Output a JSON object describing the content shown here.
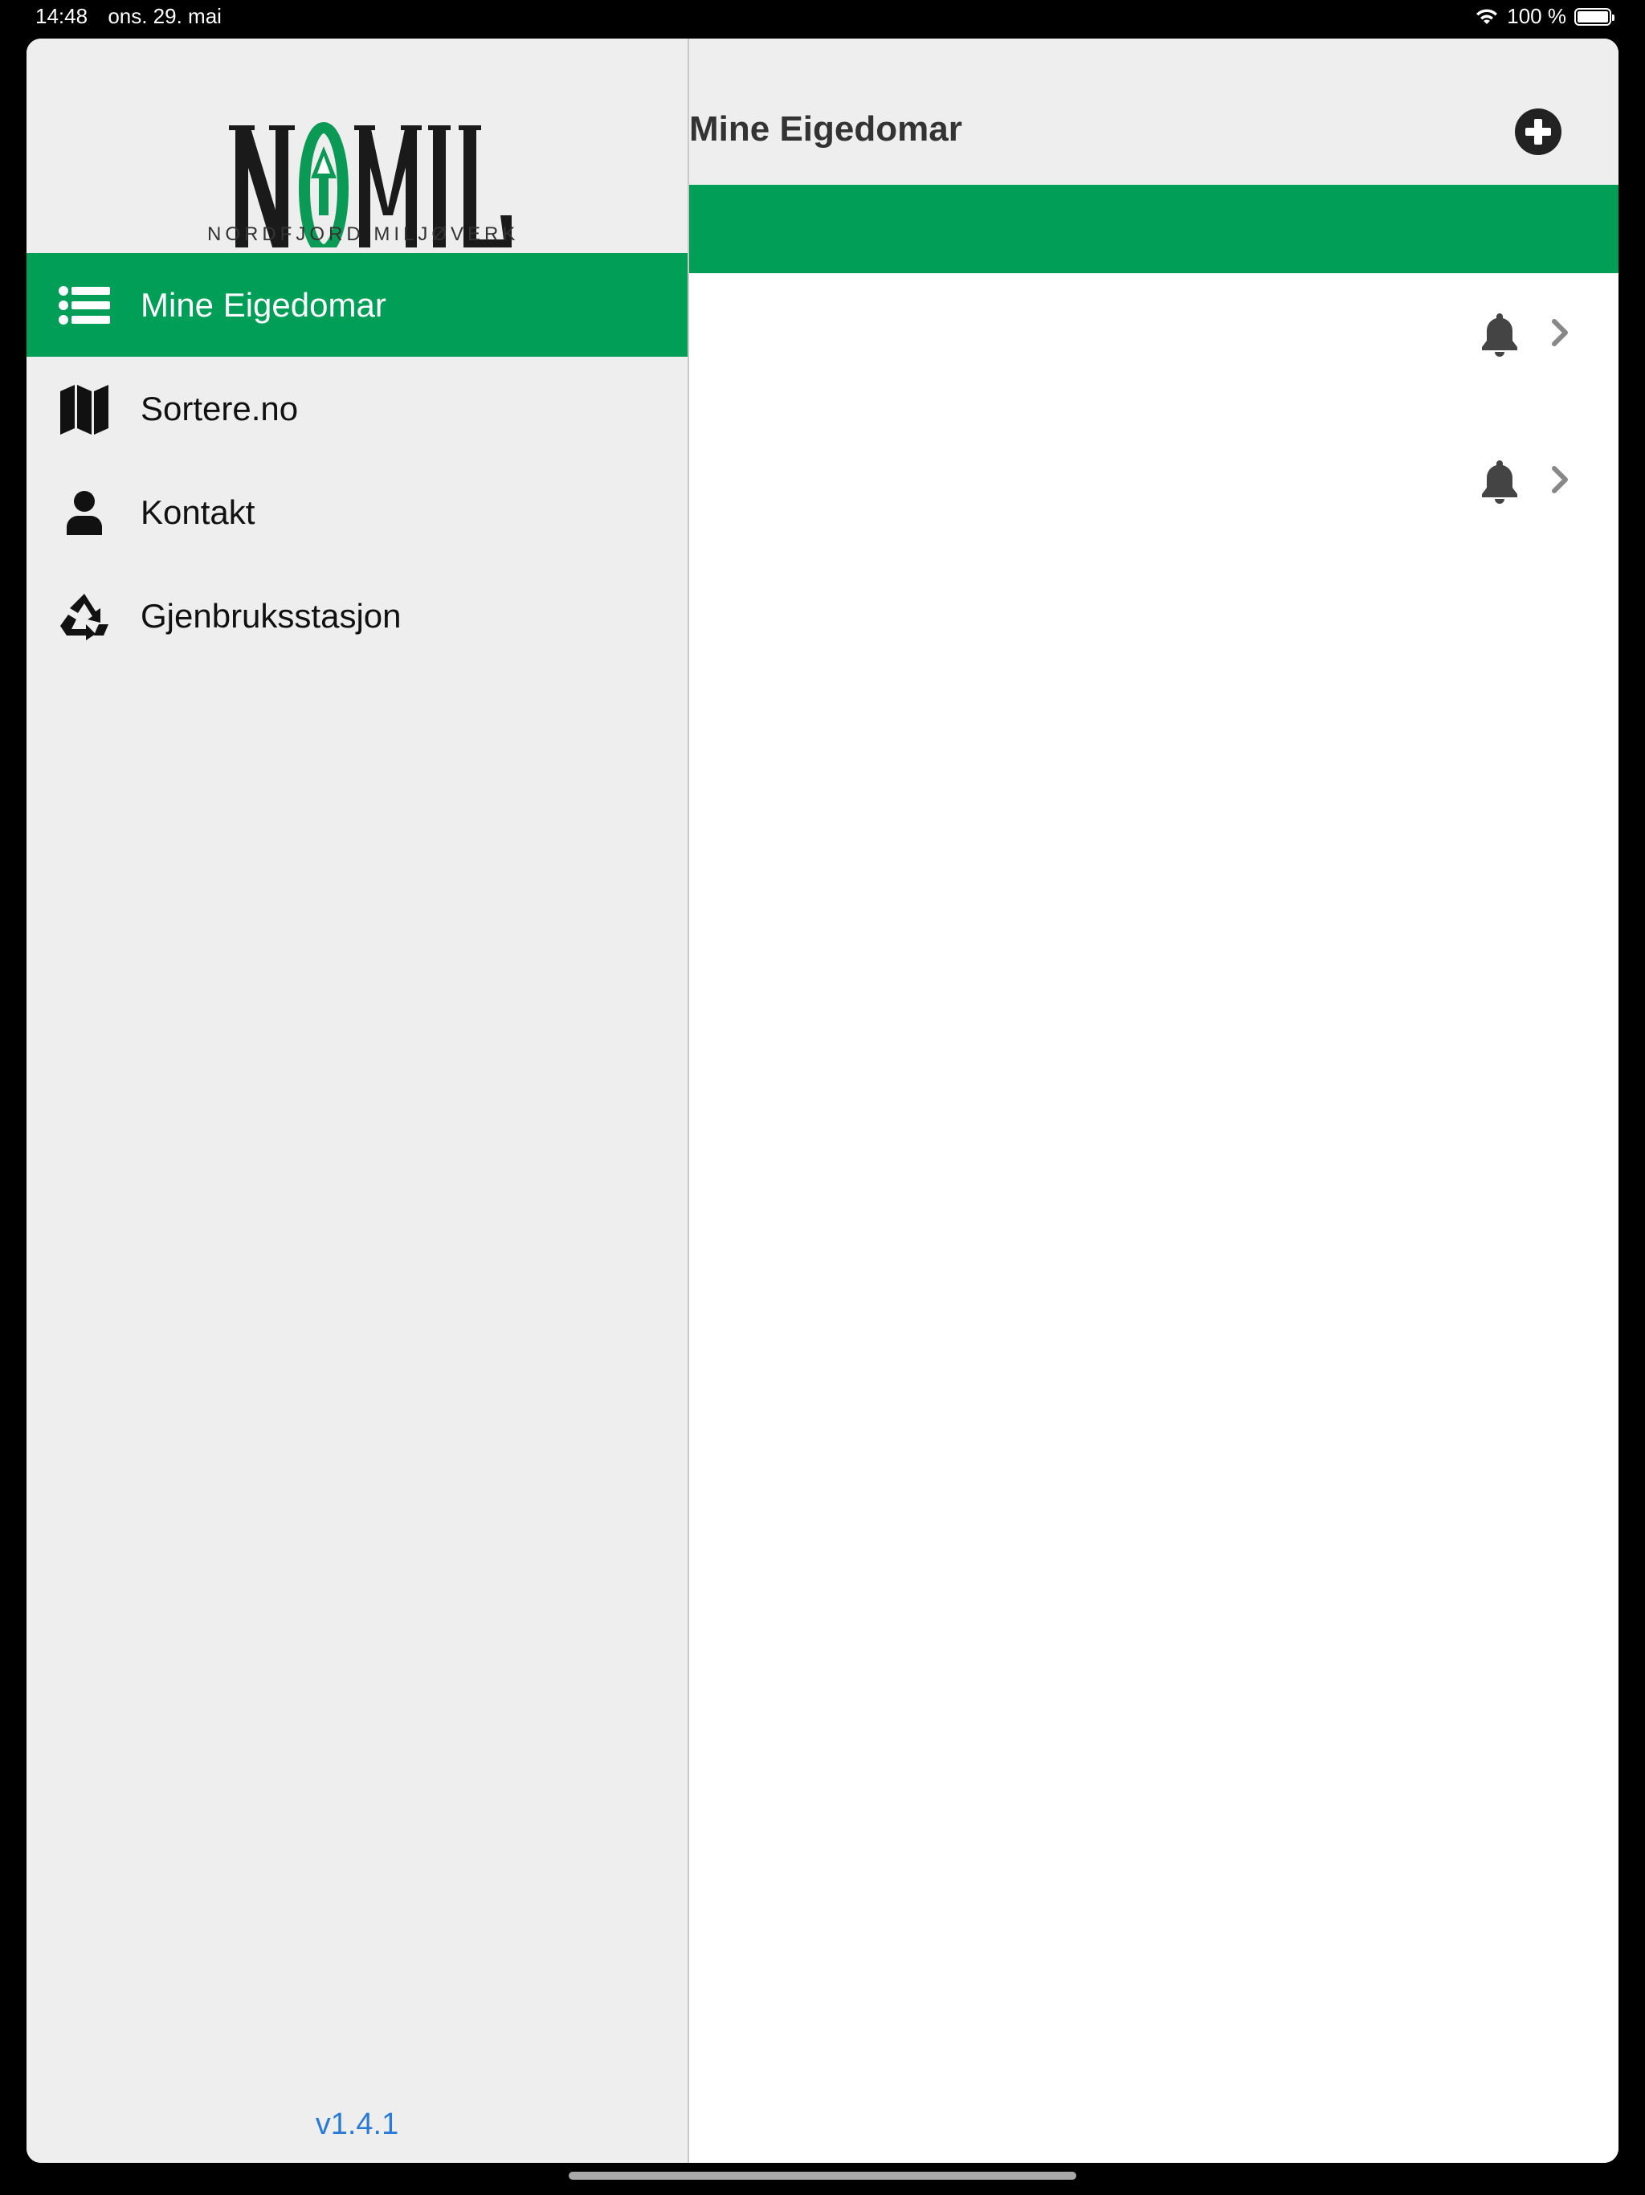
{
  "status_bar": {
    "time": "14:48",
    "date": "ons. 29. mai",
    "battery": "100 %"
  },
  "logo": {
    "name": "NOMIL",
    "subtitle": "NORDFJORD MILJØVERK"
  },
  "sidebar": {
    "items": [
      {
        "label": "Mine Eigedomar",
        "icon": "list-icon",
        "active": true
      },
      {
        "label": "Sortere.no",
        "icon": "map-icon",
        "active": false
      },
      {
        "label": "Kontakt",
        "icon": "person-icon",
        "active": false
      },
      {
        "label": "Gjenbruksstasjon",
        "icon": "recycle-icon",
        "active": false
      }
    ],
    "version": "v1.4.1"
  },
  "header": {
    "title": "Mine Eigedomar",
    "add_icon": "plus-circle-icon"
  },
  "colors": {
    "accent": "#009e57",
    "sidebar_bg": "#eeeeee",
    "link": "#2a7bd6"
  },
  "properties": [
    {
      "label": "",
      "icons": [
        "bell-icon",
        "chevron-right-icon"
      ]
    },
    {
      "label": "",
      "icons": [
        "bell-icon",
        "chevron-right-icon"
      ]
    }
  ]
}
